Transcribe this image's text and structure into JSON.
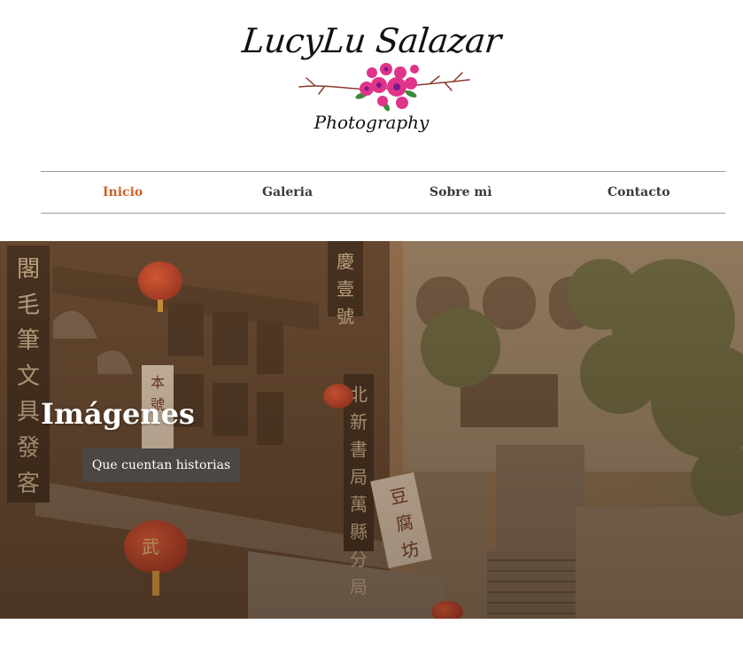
{
  "logo": {
    "name": "LucyLu Salazar",
    "subtitle": "Photography",
    "flower_color": "#e0338a",
    "branch_color": "#8a3a2a"
  },
  "nav": {
    "items": [
      {
        "label": "Inicio",
        "active": true
      },
      {
        "label": "Galeria",
        "active": false
      },
      {
        "label": "Sobre mì",
        "active": false
      },
      {
        "label": "Contacto",
        "active": false
      }
    ],
    "active_color": "#c8622a"
  },
  "hero": {
    "title": "Imágenes",
    "button_label": "Que cuentan historias",
    "signs": [
      "閣毛筆文具發客",
      "慶壹號",
      "北新書局萬縣分局",
      "豆腐坊",
      "本號"
    ],
    "lantern_char": "武",
    "tint_color": "#a0704a"
  }
}
